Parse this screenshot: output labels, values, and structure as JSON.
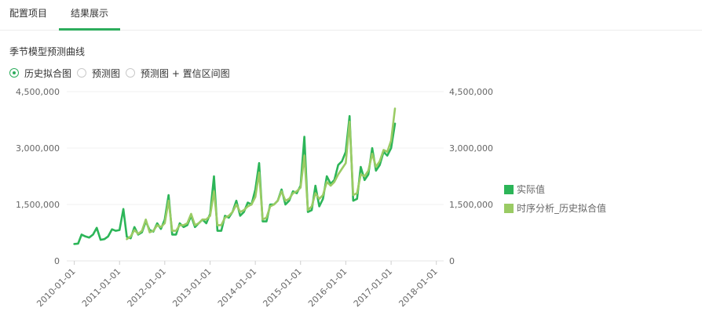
{
  "tabs": [
    {
      "label": "配置项目",
      "active": false
    },
    {
      "label": "结果展示",
      "active": true
    }
  ],
  "accent_color": "#2dad5c",
  "section_title": "季节模型预测曲线",
  "radio_options": [
    {
      "label": "历史拟合图",
      "selected": true
    },
    {
      "label": "预测图",
      "selected": false
    },
    {
      "label": "预测图 + 置信区间图",
      "selected": false
    }
  ],
  "legend": [
    {
      "label": "实际值",
      "color": "#2cb558"
    },
    {
      "label": "时序分析_历史拟合值",
      "color": "#9acb64"
    }
  ],
  "chart_data": {
    "type": "line",
    "x_ticks": [
      "2010-01-01",
      "2011-01-01",
      "2012-01-01",
      "2013-01-01",
      "2014-01-01",
      "2015-01-01",
      "2016-01-01",
      "2017-01-01",
      "2018-01-01"
    ],
    "y_left_ticks": [
      "0",
      "1,500,000",
      "3,000,000",
      "4,500,000"
    ],
    "y_right_ticks": [
      "0",
      "1,500,000",
      "3,000,000",
      "4,500,000"
    ],
    "ylim": [
      0,
      4500000
    ],
    "xlim": [
      "2009-11-01",
      "2018-03-01"
    ],
    "grid": true,
    "legend_position": "right",
    "series": [
      {
        "name": "实际值",
        "color": "#2cb558",
        "points": [
          [
            "2010-01-01",
            450000
          ],
          [
            "2010-02-01",
            460000
          ],
          [
            "2010-03-01",
            700000
          ],
          [
            "2010-04-01",
            650000
          ],
          [
            "2010-05-01",
            620000
          ],
          [
            "2010-06-01",
            700000
          ],
          [
            "2010-07-01",
            880000
          ],
          [
            "2010-08-01",
            560000
          ],
          [
            "2010-09-01",
            580000
          ],
          [
            "2010-10-01",
            650000
          ],
          [
            "2010-11-01",
            840000
          ],
          [
            "2010-12-01",
            800000
          ],
          [
            "2011-01-01",
            820000
          ],
          [
            "2011-02-01",
            1380000
          ],
          [
            "2011-03-01",
            640000
          ],
          [
            "2011-04-01",
            600000
          ],
          [
            "2011-05-01",
            900000
          ],
          [
            "2011-06-01",
            700000
          ],
          [
            "2011-07-01",
            760000
          ],
          [
            "2011-08-01",
            1050000
          ],
          [
            "2011-09-01",
            820000
          ],
          [
            "2011-10-01",
            780000
          ],
          [
            "2011-11-01",
            1000000
          ],
          [
            "2011-12-01",
            850000
          ],
          [
            "2012-01-01",
            1100000
          ],
          [
            "2012-02-01",
            1750000
          ],
          [
            "2012-03-01",
            700000
          ],
          [
            "2012-04-01",
            700000
          ],
          [
            "2012-05-01",
            1000000
          ],
          [
            "2012-06-01",
            900000
          ],
          [
            "2012-07-01",
            950000
          ],
          [
            "2012-08-01",
            1200000
          ],
          [
            "2012-09-01",
            900000
          ],
          [
            "2012-10-01",
            1000000
          ],
          [
            "2012-11-01",
            1100000
          ],
          [
            "2012-12-01",
            1000000
          ],
          [
            "2013-01-01",
            1250000
          ],
          [
            "2013-02-01",
            2250000
          ],
          [
            "2013-03-01",
            800000
          ],
          [
            "2013-04-01",
            800000
          ],
          [
            "2013-05-01",
            1200000
          ],
          [
            "2013-06-01",
            1150000
          ],
          [
            "2013-07-01",
            1300000
          ],
          [
            "2013-08-01",
            1600000
          ],
          [
            "2013-09-01",
            1200000
          ],
          [
            "2013-10-01",
            1300000
          ],
          [
            "2013-11-01",
            1550000
          ],
          [
            "2013-12-01",
            1500000
          ],
          [
            "2014-01-01",
            1900000
          ],
          [
            "2014-02-01",
            2600000
          ],
          [
            "2014-03-01",
            1050000
          ],
          [
            "2014-04-01",
            1050000
          ],
          [
            "2014-05-01",
            1500000
          ],
          [
            "2014-06-01",
            1500000
          ],
          [
            "2014-07-01",
            1600000
          ],
          [
            "2014-08-01",
            1900000
          ],
          [
            "2014-09-01",
            1500000
          ],
          [
            "2014-10-01",
            1600000
          ],
          [
            "2014-11-01",
            1850000
          ],
          [
            "2014-12-01",
            1800000
          ],
          [
            "2015-01-01",
            2000000
          ],
          [
            "2015-02-01",
            3300000
          ],
          [
            "2015-03-01",
            1300000
          ],
          [
            "2015-04-01",
            1350000
          ],
          [
            "2015-05-01",
            2000000
          ],
          [
            "2015-06-01",
            1450000
          ],
          [
            "2015-07-01",
            1650000
          ],
          [
            "2015-08-01",
            2250000
          ],
          [
            "2015-09-01",
            2050000
          ],
          [
            "2015-10-01",
            2150000
          ],
          [
            "2015-11-01",
            2550000
          ],
          [
            "2015-12-01",
            2650000
          ],
          [
            "2016-01-01",
            2900000
          ],
          [
            "2016-02-01",
            3850000
          ],
          [
            "2016-03-01",
            1600000
          ],
          [
            "2016-04-01",
            1650000
          ],
          [
            "2016-05-01",
            2500000
          ],
          [
            "2016-06-01",
            2150000
          ],
          [
            "2016-07-01",
            2300000
          ],
          [
            "2016-08-01",
            3000000
          ],
          [
            "2016-09-01",
            2400000
          ],
          [
            "2016-10-01",
            2550000
          ],
          [
            "2016-11-01",
            2900000
          ],
          [
            "2016-12-01",
            2800000
          ],
          [
            "2017-01-01",
            3000000
          ],
          [
            "2017-02-01",
            3650000
          ]
        ]
      },
      {
        "name": "时序分析_历史拟合值",
        "color": "#9acb64",
        "points": [
          [
            "2011-03-01",
            580000
          ],
          [
            "2011-04-01",
            650000
          ],
          [
            "2011-05-01",
            820000
          ],
          [
            "2011-06-01",
            720000
          ],
          [
            "2011-07-01",
            800000
          ],
          [
            "2011-08-01",
            1100000
          ],
          [
            "2011-09-01",
            760000
          ],
          [
            "2011-10-01",
            800000
          ],
          [
            "2011-11-01",
            950000
          ],
          [
            "2011-12-01",
            900000
          ],
          [
            "2012-01-01",
            1000000
          ],
          [
            "2012-02-01",
            1600000
          ],
          [
            "2012-03-01",
            800000
          ],
          [
            "2012-04-01",
            800000
          ],
          [
            "2012-05-01",
            950000
          ],
          [
            "2012-06-01",
            950000
          ],
          [
            "2012-07-01",
            1000000
          ],
          [
            "2012-08-01",
            1250000
          ],
          [
            "2012-09-01",
            950000
          ],
          [
            "2012-10-01",
            1000000
          ],
          [
            "2012-11-01",
            1100000
          ],
          [
            "2012-12-01",
            1100000
          ],
          [
            "2013-01-01",
            1200000
          ],
          [
            "2013-02-01",
            1850000
          ],
          [
            "2013-03-01",
            950000
          ],
          [
            "2013-04-01",
            950000
          ],
          [
            "2013-05-01",
            1150000
          ],
          [
            "2013-06-01",
            1200000
          ],
          [
            "2013-07-01",
            1300000
          ],
          [
            "2013-08-01",
            1500000
          ],
          [
            "2013-09-01",
            1300000
          ],
          [
            "2013-10-01",
            1350000
          ],
          [
            "2013-11-01",
            1450000
          ],
          [
            "2013-12-01",
            1500000
          ],
          [
            "2014-01-01",
            1700000
          ],
          [
            "2014-02-01",
            2350000
          ],
          [
            "2014-03-01",
            1100000
          ],
          [
            "2014-04-01",
            1150000
          ],
          [
            "2014-05-01",
            1450000
          ],
          [
            "2014-06-01",
            1500000
          ],
          [
            "2014-07-01",
            1600000
          ],
          [
            "2014-08-01",
            1850000
          ],
          [
            "2014-09-01",
            1600000
          ],
          [
            "2014-10-01",
            1650000
          ],
          [
            "2014-11-01",
            1800000
          ],
          [
            "2014-12-01",
            1850000
          ],
          [
            "2015-01-01",
            1950000
          ],
          [
            "2015-02-01",
            2800000
          ],
          [
            "2015-03-01",
            1350000
          ],
          [
            "2015-04-01",
            1450000
          ],
          [
            "2015-05-01",
            1800000
          ],
          [
            "2015-06-01",
            1650000
          ],
          [
            "2015-07-01",
            1750000
          ],
          [
            "2015-08-01",
            2100000
          ],
          [
            "2015-09-01",
            2000000
          ],
          [
            "2015-10-01",
            2100000
          ],
          [
            "2015-11-01",
            2300000
          ],
          [
            "2015-12-01",
            2450000
          ],
          [
            "2016-01-01",
            2600000
          ],
          [
            "2016-02-01",
            3700000
          ],
          [
            "2016-03-01",
            1750000
          ],
          [
            "2016-04-01",
            1800000
          ],
          [
            "2016-05-01",
            2300000
          ],
          [
            "2016-06-01",
            2250000
          ],
          [
            "2016-07-01",
            2400000
          ],
          [
            "2016-08-01",
            2850000
          ],
          [
            "2016-09-01",
            2500000
          ],
          [
            "2016-10-01",
            2650000
          ],
          [
            "2016-11-01",
            2950000
          ],
          [
            "2016-12-01",
            2900000
          ],
          [
            "2017-01-01",
            3200000
          ],
          [
            "2017-02-01",
            4050000
          ]
        ]
      }
    ]
  }
}
